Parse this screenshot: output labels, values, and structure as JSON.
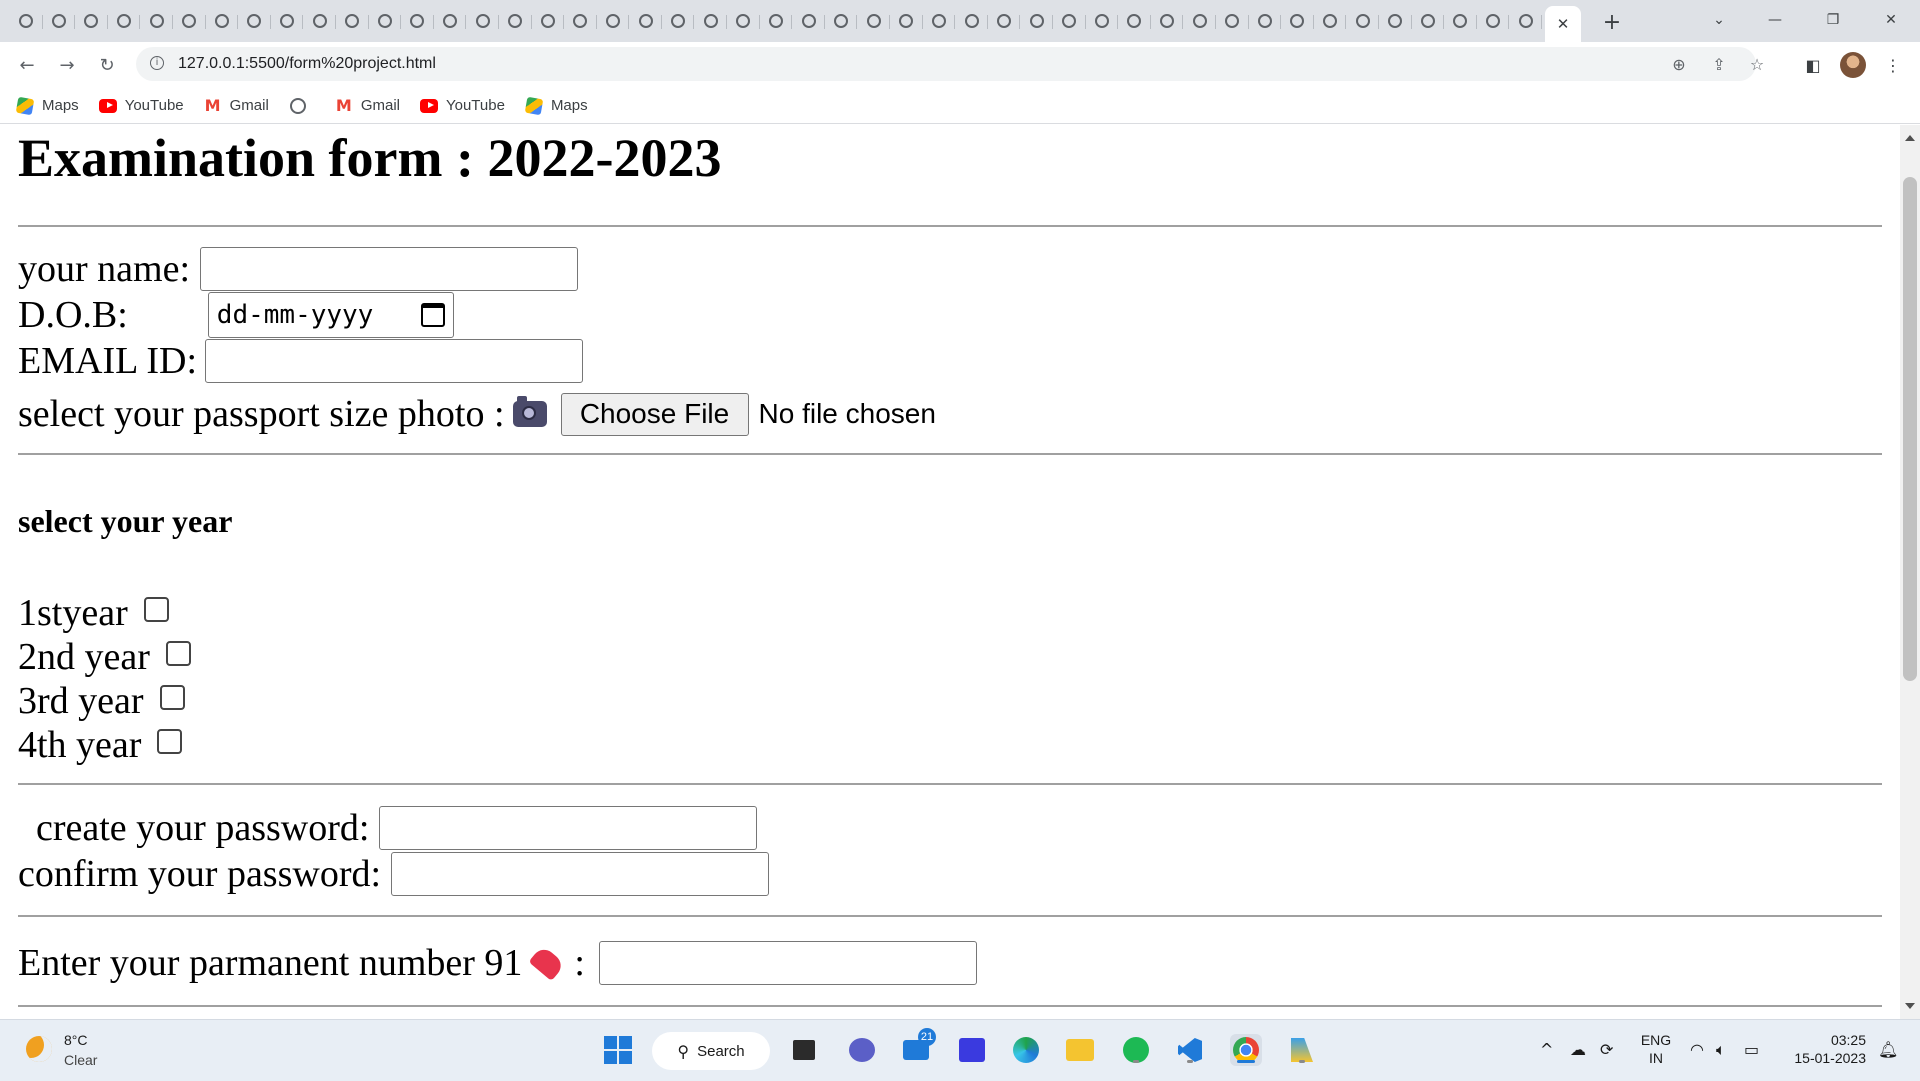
{
  "browser": {
    "tab_count": 47,
    "active_tab_close": "✕",
    "new_tab": "+",
    "window_controls": {
      "tab_search": "⌄",
      "minimize": "—",
      "restore": "❐",
      "close": "✕"
    },
    "address_bar": {
      "url": "127.0.0.1:5500/form%20project.html"
    },
    "bookmarks": [
      {
        "label": "Maps",
        "icon": "maps-icon"
      },
      {
        "label": "YouTube",
        "icon": "youtube-icon"
      },
      {
        "label": "Gmail",
        "icon": "gmail-icon"
      },
      {
        "label": "",
        "icon": "globe-icon"
      },
      {
        "label": "Gmail",
        "icon": "gmail-icon"
      },
      {
        "label": "YouTube",
        "icon": "youtube-icon"
      },
      {
        "label": "Maps",
        "icon": "maps-icon"
      }
    ]
  },
  "page": {
    "title": "Examination form : 2022-2023",
    "name_label": "your name:",
    "dob_label": "D.O.B:",
    "dob_placeholder": "dd-mm-yyyy",
    "email_label": "EMAIL ID:",
    "photo_label": "select your passport size photo :",
    "choose_file_label": "Choose File",
    "file_status": "No file chosen",
    "year_heading": "select your year",
    "years": [
      "1styear",
      "2nd year",
      "3rd year",
      "4th year"
    ],
    "create_password_label": "create your password:",
    "confirm_password_label": "confirm your password:",
    "phone_label": "Enter your parmanent number 91",
    "phone_colon": ":"
  },
  "taskbar": {
    "weather": {
      "temp": "8°C",
      "condition": "Clear"
    },
    "search_label": "Search",
    "mail_badge": "21",
    "language": {
      "line1": "ENG",
      "line2": "IN"
    },
    "clock": {
      "time": "03:25",
      "date": "15-01-2023"
    }
  },
  "colors": {
    "tabstrip": "#dee1e6",
    "omnibox": "#f1f3f4",
    "taskbar": "#e8eef5",
    "accent": "#1f7ad8"
  }
}
